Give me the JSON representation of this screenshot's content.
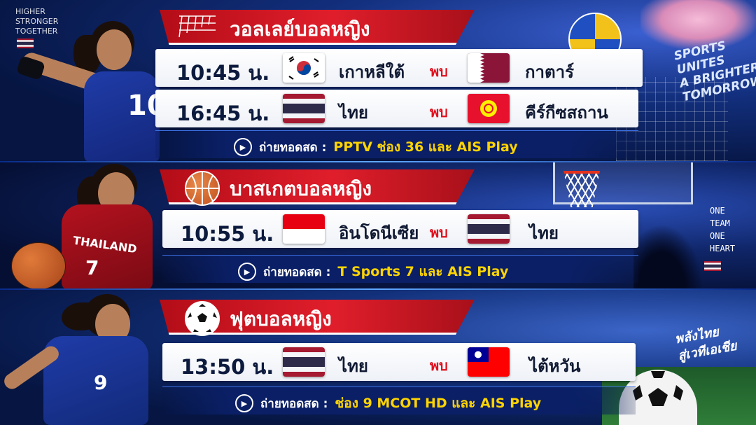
{
  "corner_text": {
    "top_left_lines": [
      "HIGHER",
      "STRONGER",
      "TOGETHER"
    ],
    "right_slogan_lines": [
      "SPORTS",
      "UNITES",
      "A BRIGHTER",
      "TOMORROW"
    ],
    "right_mid_lines": [
      "ONE",
      "TEAM",
      "ONE",
      "HEART"
    ],
    "bottom_right_script_lines": [
      "พลังไทย",
      "สู่เวทีเอเชีย"
    ]
  },
  "sections": [
    {
      "title": "วอลเลย์บอลหญิง",
      "icon": "volleyball-net-icon",
      "matches": [
        {
          "time": "10:45 น.",
          "home": "เกาหลีใต้",
          "home_flag": "south-korea-flag",
          "vs": "พบ",
          "away": "กาตาร์",
          "away_flag": "qatar-flag"
        },
        {
          "time": "16:45 น.",
          "home": "ไทย",
          "home_flag": "thailand-flag",
          "vs": "พบ",
          "away": "คีร์กีซสถาน",
          "away_flag": "kyrgyzstan-flag"
        }
      ],
      "broadcast_label": "ถ่ายทอดสด :",
      "broadcast_channel": "PPTV ช่อง 36 และ AIS Play",
      "athlete_number": "10"
    },
    {
      "title": "บาสเกตบอลหญิง",
      "icon": "basketball-icon",
      "matches": [
        {
          "time": "10:55 น.",
          "home": "อินโดนีเซีย",
          "home_flag": "indonesia-flag",
          "vs": "พบ",
          "away": "ไทย",
          "away_flag": "thailand-flag"
        }
      ],
      "broadcast_label": "ถ่ายทอดสด :",
      "broadcast_channel": "T Sports 7 และ AIS Play",
      "athlete_jersey_text": "THAILAND",
      "athlete_number": "7"
    },
    {
      "title": "ฟุตบอลหญิง",
      "icon": "soccer-ball-icon",
      "matches": [
        {
          "time": "13:50 น.",
          "home": "ไทย",
          "home_flag": "thailand-flag",
          "vs": "พบ",
          "away": "ไต้หวัน",
          "away_flag": "taiwan-flag"
        }
      ],
      "broadcast_label": "ถ่ายทอดสด :",
      "broadcast_channel": "ช่อง 9 MCOT HD และ AIS Play",
      "athlete_number": "9"
    }
  ],
  "colors": {
    "ribbon_red": "#e01e2b",
    "vs_red": "#e0101e",
    "channel_yellow": "#ffd400",
    "navy": "#0a1f66"
  }
}
